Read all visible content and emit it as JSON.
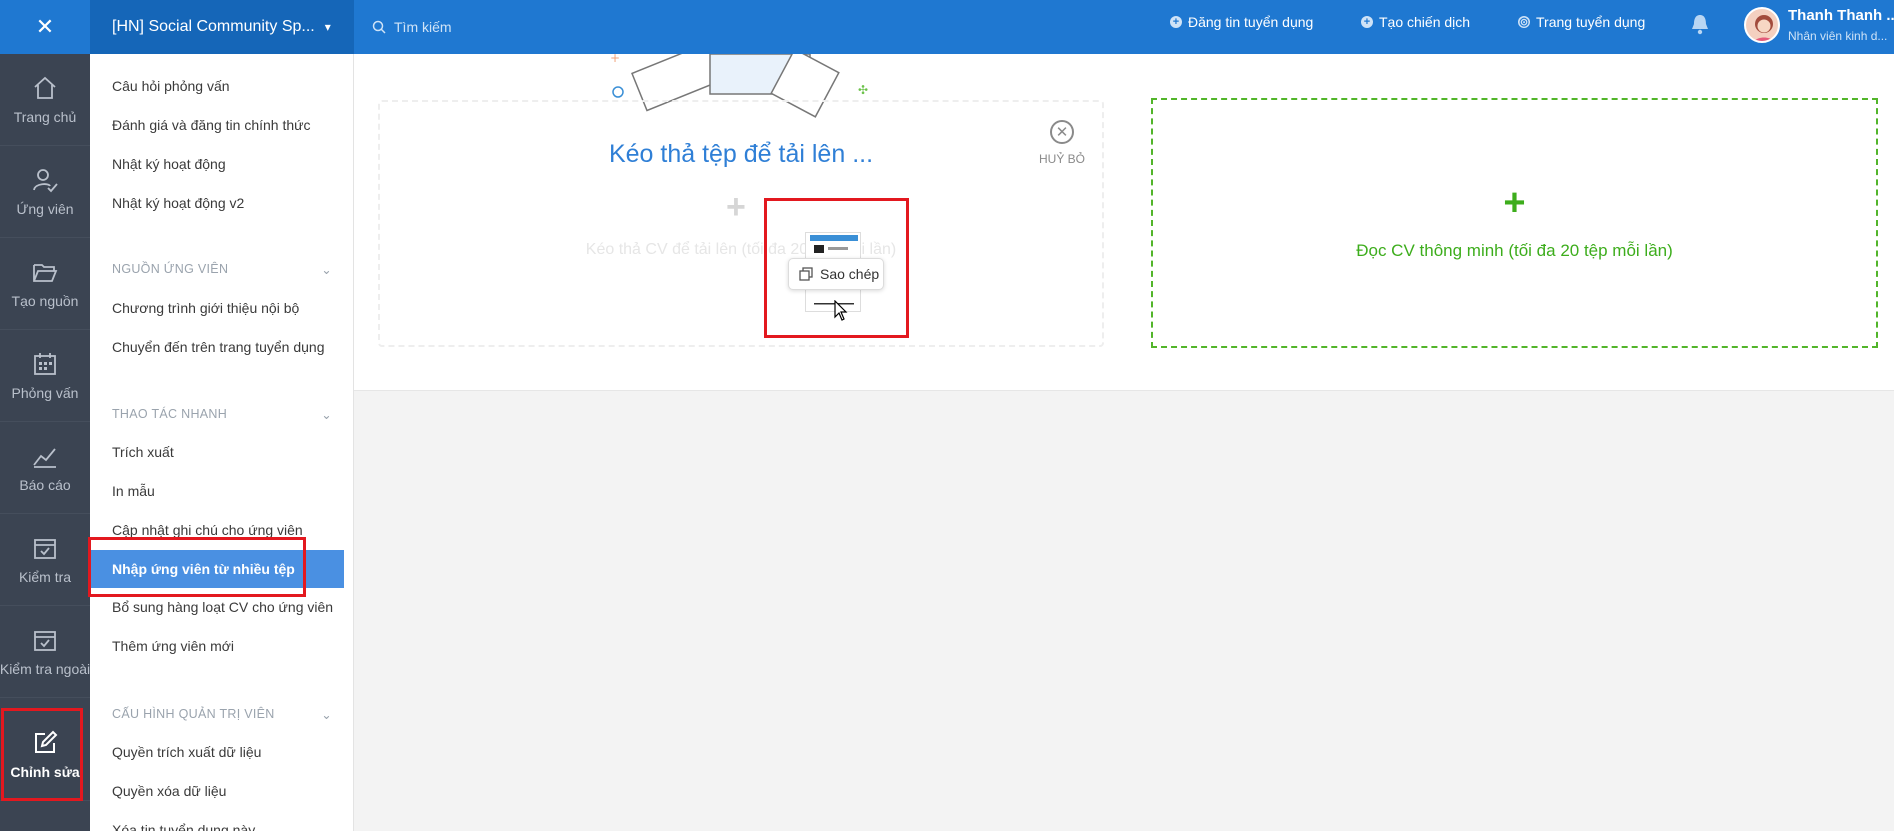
{
  "topbar": {
    "workspace": "[HN] Social Community Sp...",
    "search_placeholder": "Tìm kiếm",
    "links": [
      "Đăng tin tuyển dụng",
      "Tạo chiến dịch",
      "Trang tuyển dụng"
    ],
    "user_name": "Thanh Thanh ...",
    "user_role": "Nhân viên kinh d..."
  },
  "rail": [
    "Trang chủ",
    "Ứng viên",
    "Tạo nguồn",
    "Phỏng vấn",
    "Báo cáo",
    "Kiểm tra",
    "Kiểm tra ngoài",
    "Chỉnh sửa"
  ],
  "menu": {
    "top_items": [
      "Câu hỏi phỏng vấn",
      "Đánh giá và đăng tin chính thức",
      "Nhật ký hoạt động",
      "Nhật ký hoạt động v2"
    ],
    "section_source": "Nguồn ứng viên",
    "source_items": [
      "Chương trình giới thiệu nội bộ",
      "Chuyển đến trên trang tuyển dụng"
    ],
    "section_quick": "Thao tác nhanh",
    "quick_items": [
      "Trích xuất",
      "In mẫu",
      "Cập nhật ghi chú cho ứng viên",
      "Nhập ứng viên từ nhiều tệp",
      "Bổ sung hàng loạt CV cho ứng viên",
      "Thêm ứng viên mới"
    ],
    "section_admin": "Cấu hình quản trị viên",
    "admin_items": [
      "Quyền trích xuất dữ liệu",
      "Quyền xóa dữ liệu",
      "Xóa tin tuyển dụng này"
    ]
  },
  "main": {
    "drop_title": "Kéo thả tệp để tải lên ...",
    "drop_hint": "Kéo thả CV để tải lên (tối đa 20 tệp mỗi lần)",
    "cancel_label": "HUỶ BỎ",
    "cv_text": "Đọc CV thông minh (tối đa 20 tệp mỗi lần)",
    "copy_tip": "Sao chép"
  },
  "colors": {
    "topbar": "#1f78d1",
    "rail": "#3b4452",
    "accent_green": "#3dad1c",
    "active_menu": "#4a90e2",
    "highlight": "#e3181f"
  }
}
